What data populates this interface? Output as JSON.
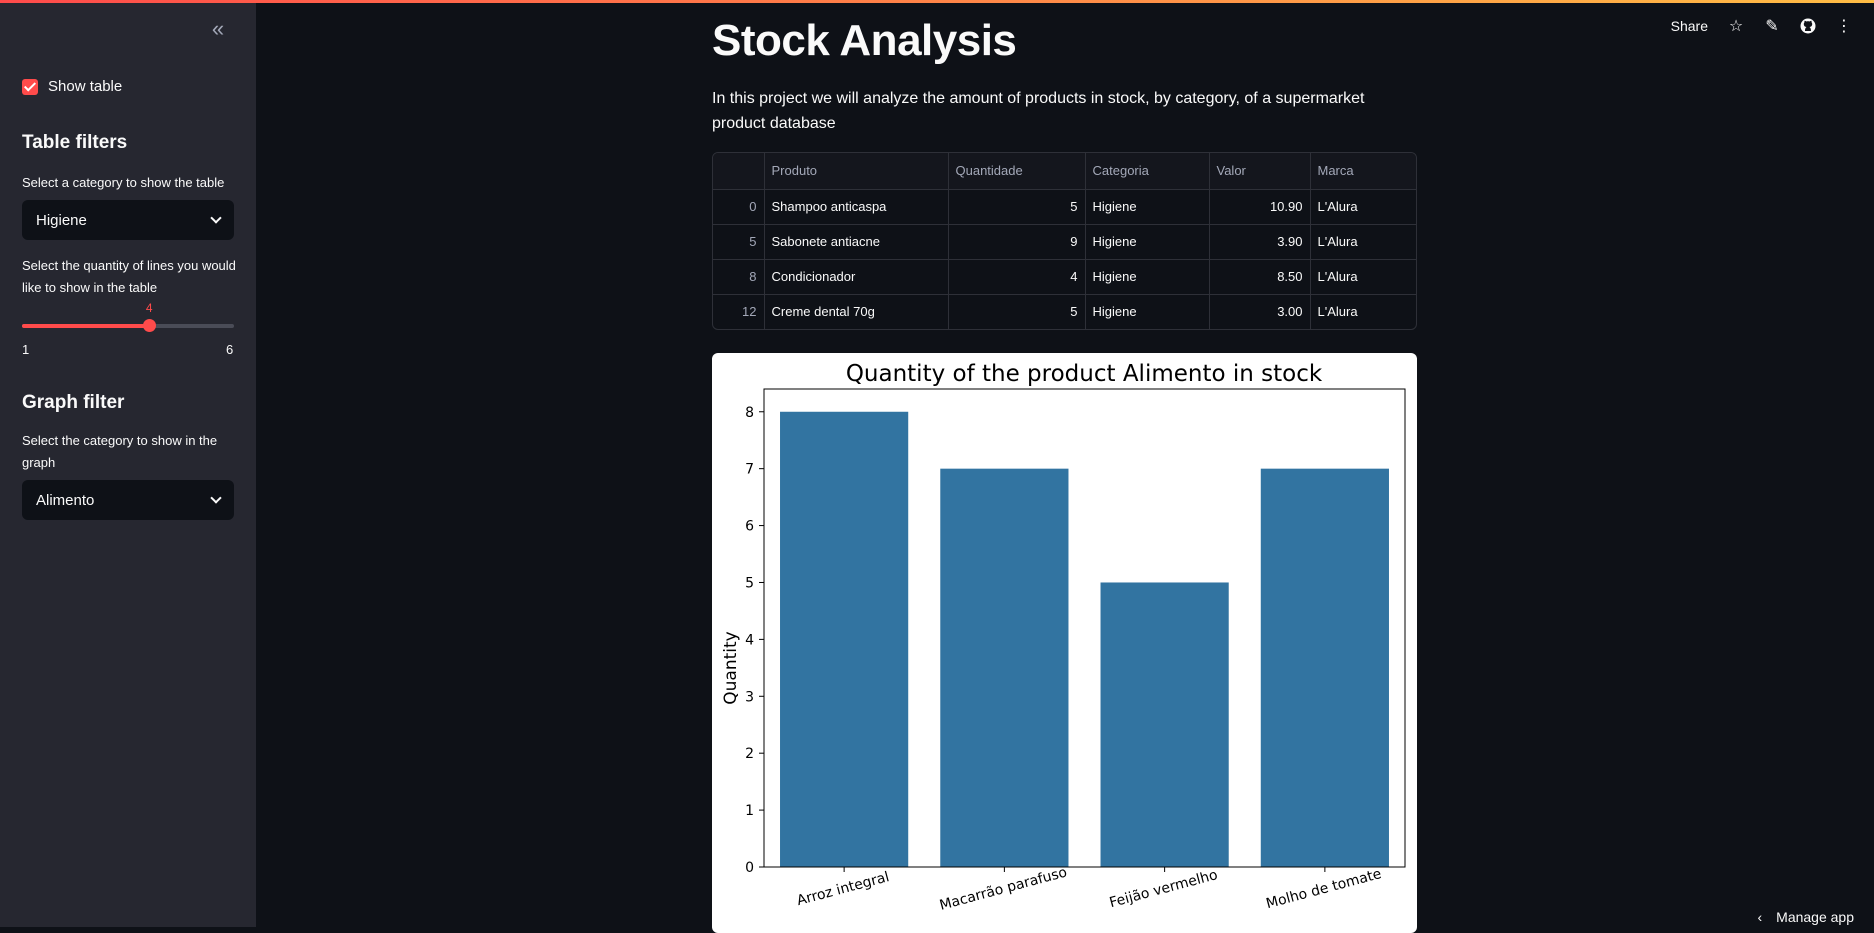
{
  "sidebar": {
    "collapse_icon": "double-chevron-left-icon",
    "show_table_label": "Show table",
    "table_filters_title": "Table filters",
    "table_category_label": "Select a category to show the table",
    "table_category_value": "Higiene",
    "lines_label": "Select the quantity of lines you would like to show in the table",
    "lines_slider": {
      "value": "4",
      "min": "1",
      "max": "6",
      "fraction": 0.6
    },
    "graph_filter_title": "Graph filter",
    "graph_category_label": "Select the category to show in the graph",
    "graph_category_value": "Alimento"
  },
  "toolbar": {
    "share_label": "Share"
  },
  "main": {
    "title": "Stock Analysis",
    "intro": "In this project we will analyze the amount of products in stock, by category, of a supermarket product database"
  },
  "table": {
    "columns": [
      "",
      "Produto",
      "Quantidade",
      "Categoria",
      "Valor",
      "Marca"
    ],
    "rows": [
      [
        "0",
        "Shampoo anticaspa",
        "5",
        "Higiene",
        "10.90",
        "L'Alura"
      ],
      [
        "5",
        "Sabonete antiacne",
        "9",
        "Higiene",
        "3.90",
        "L'Alura"
      ],
      [
        "8",
        "Condicionador",
        "4",
        "Higiene",
        "8.50",
        "L'Alura"
      ],
      [
        "12",
        "Creme dental 70g",
        "5",
        "Higiene",
        "3.00",
        "L'Alura"
      ]
    ]
  },
  "chart_data": {
    "type": "bar",
    "title": "Quantity of the product Alimento in stock",
    "ylabel": "Quantity",
    "xlabel": "",
    "categories": [
      "Arroz integral",
      "Macarrão parafuso",
      "Feijão vermelho",
      "Molho de tomate"
    ],
    "values": [
      8,
      7,
      5,
      7
    ],
    "ylim": [
      0,
      8.4
    ],
    "yticks": [
      "0",
      "1",
      "2",
      "3",
      "4",
      "5",
      "6",
      "7",
      "8"
    ],
    "bar_color": "#3274a1",
    "grid": false
  },
  "footer": {
    "manage_label": "Manage app"
  }
}
